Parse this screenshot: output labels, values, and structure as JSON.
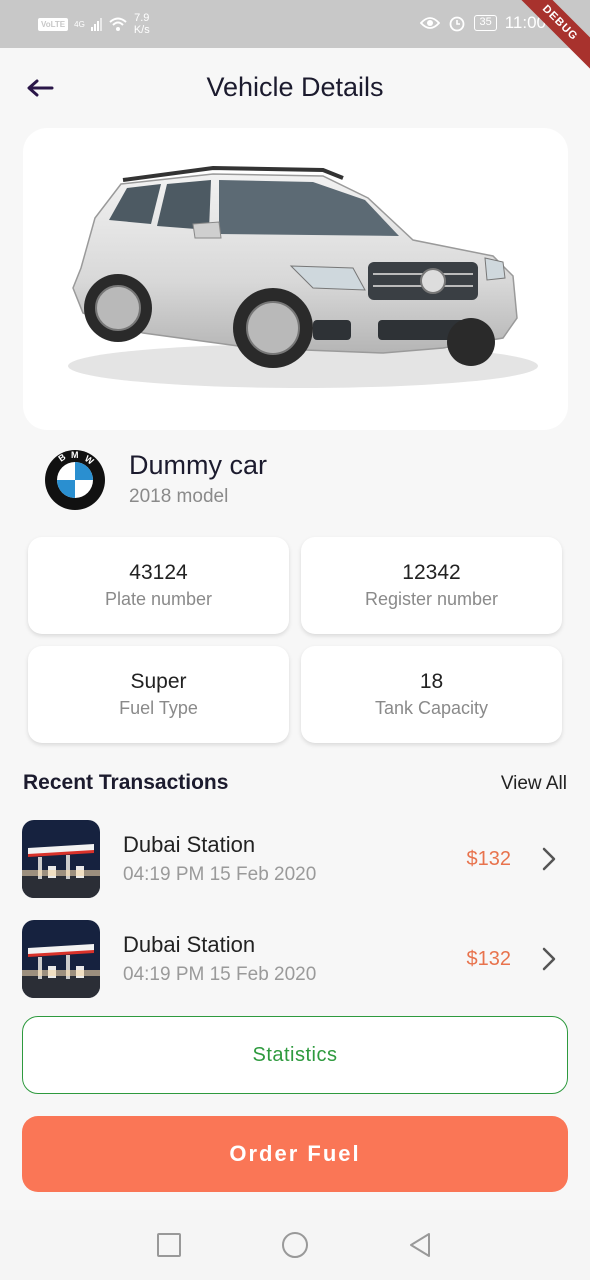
{
  "status_bar": {
    "volte": "VoLTE",
    "network": "4G",
    "speed_value": "7.9",
    "speed_unit": "K/s",
    "battery": "35",
    "time": "11:00",
    "debug_label": "DEBUG"
  },
  "header": {
    "title": "Vehicle Details",
    "back_icon": "arrow-left-icon"
  },
  "vehicle": {
    "name": "Dummy car",
    "model": "2018 model",
    "brand_logo": "bmw-logo",
    "bmw_letters": [
      "B",
      "M",
      "W"
    ]
  },
  "details": [
    {
      "value": "43124",
      "label": "Plate number"
    },
    {
      "value": "12342",
      "label": "Register number"
    },
    {
      "value": "Super",
      "label": "Fuel Type"
    },
    {
      "value": "18",
      "label": "Tank Capacity"
    }
  ],
  "transactions": {
    "title": "Recent Transactions",
    "view_all": "View All",
    "items": [
      {
        "name": "Dubai Station",
        "date": "04:19 PM 15 Feb 2020",
        "amount": "$132"
      },
      {
        "name": "Dubai Station",
        "date": "04:19 PM 15 Feb 2020",
        "amount": "$132"
      }
    ]
  },
  "buttons": {
    "statistics": "Statistics",
    "order_fuel": "Order Fuel"
  },
  "colors": {
    "accent_orange": "#fa7656",
    "amount_orange": "#e8734d",
    "statistics_green": "#2e9a3e",
    "debug_red": "#a8322d"
  },
  "nav_bar": {
    "icons": [
      "square-icon",
      "circle-icon",
      "triangle-back-icon"
    ]
  }
}
